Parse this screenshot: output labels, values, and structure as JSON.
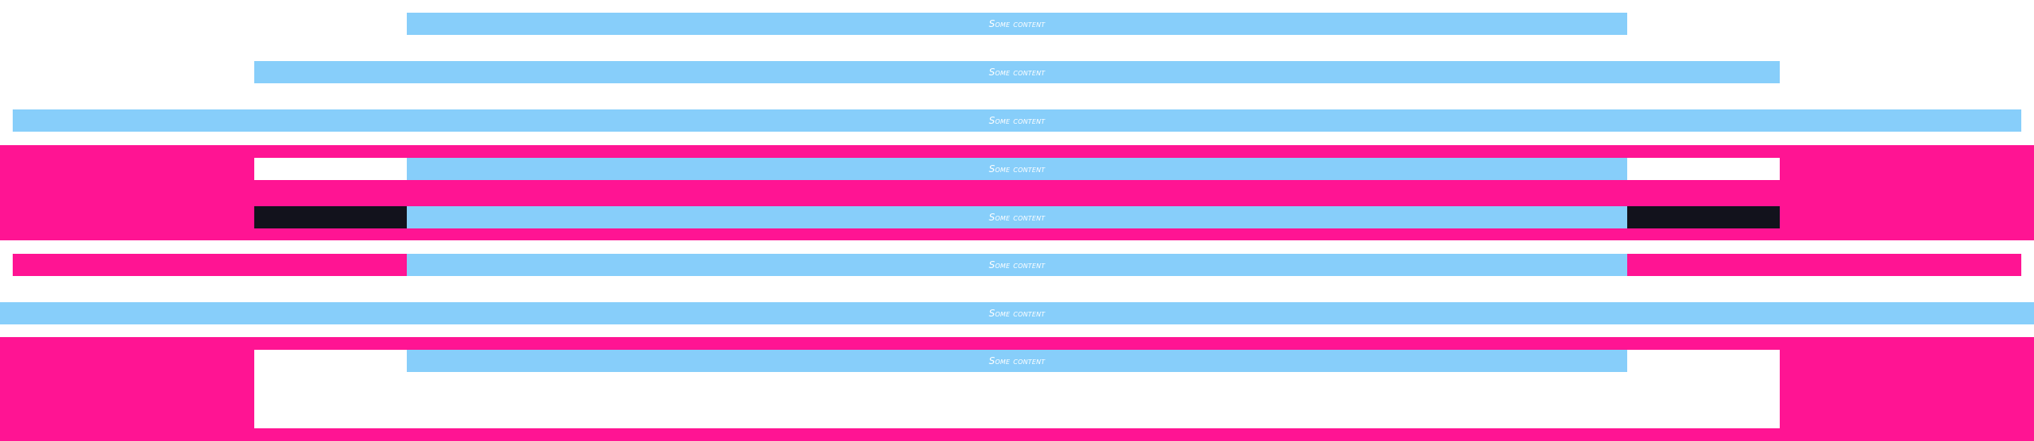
{
  "colors": {
    "content_bar": "#87cefa",
    "accent_pink": "#ff1493",
    "dark_box": "#12121c",
    "background": "#ffffff",
    "label_text": "#ffffff"
  },
  "rows": [
    {
      "label": "Some content"
    },
    {
      "label": "Some content"
    },
    {
      "label": "Some content"
    },
    {
      "label": "Some content"
    },
    {
      "label": "Some content"
    },
    {
      "label": "Some content"
    },
    {
      "label": "Some content"
    },
    {
      "label": "Some content"
    }
  ]
}
